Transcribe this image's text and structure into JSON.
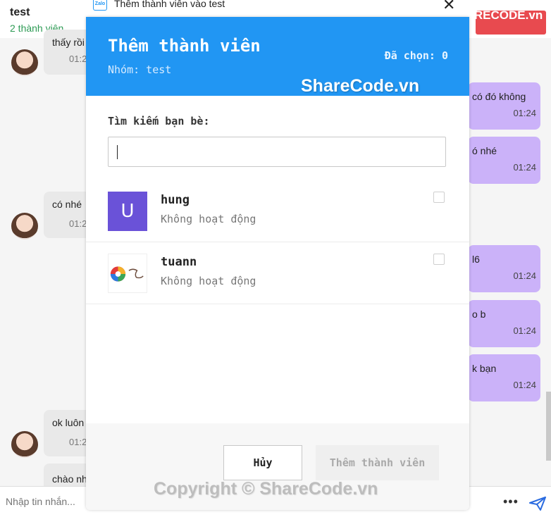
{
  "chat": {
    "title": "test",
    "member_count": "2 thành viên",
    "incoming": [
      {
        "text": "thấy rồi",
        "time": "01:2"
      },
      {
        "text": "có nhé",
        "time": "01:2"
      },
      {
        "text": "ok luôn",
        "time": "01:2"
      },
      {
        "text": "chào nh",
        "time": ""
      }
    ],
    "outgoing": [
      {
        "text": "có đó không",
        "time": "01:24"
      },
      {
        "text": "ó nhé",
        "time": "01:24"
      },
      {
        "text": "l6",
        "time": "01:24"
      },
      {
        "text": "o b",
        "time": "01:24"
      },
      {
        "text": "k bạn",
        "time": "01:24"
      }
    ],
    "input_placeholder": "Nhập tin nhắn...",
    "more_icon": "•••",
    "send_icon": "send-icon"
  },
  "window": {
    "title": "Thêm thành viên vào test",
    "app_icon_text": "Zalo",
    "close_symbol": "✕"
  },
  "modal": {
    "heading": "Thêm thành viên",
    "group_label": "Nhóm: test",
    "selected_label": "Đã chọn: 0",
    "search_label": "Tìm kiếm bạn bè:",
    "search_value": "",
    "friends": [
      {
        "name": "hung",
        "status": "Không hoạt động",
        "avatar_letter": "U",
        "checked": false
      },
      {
        "name": "tuann",
        "status": "Không hoạt động",
        "avatar_letter": "",
        "checked": false
      }
    ],
    "cancel_label": "Hủy",
    "add_label": "Thêm thành viên"
  },
  "watermarks": {
    "top_logo": "SHARECODE.vn",
    "center": "ShareCode.vn",
    "bottom": "Copyright © ShareCode.vn"
  },
  "colors": {
    "modal_header": "#2196f3",
    "outgoing_bubble": "#cbb2f9",
    "avatar_u": "#6a52d8"
  }
}
